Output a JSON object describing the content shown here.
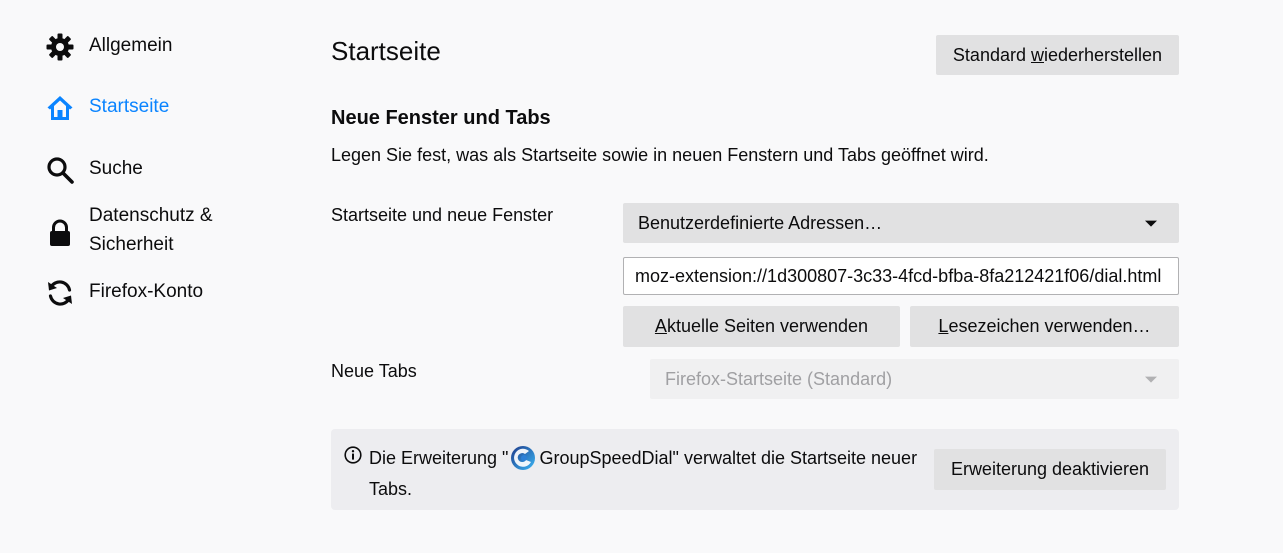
{
  "sidebar": {
    "items": [
      {
        "label": "Allgemein",
        "icon": "gear-icon"
      },
      {
        "label": "Startseite",
        "icon": "home-icon",
        "selected": true
      },
      {
        "label": "Suche",
        "icon": "search-icon"
      },
      {
        "label": "Datenschutz & Sicherheit",
        "icon": "lock-icon"
      },
      {
        "label": "Firefox-Konto",
        "icon": "sync-icon"
      }
    ]
  },
  "main": {
    "title": "Startseite",
    "restore_button": {
      "prefix": "Standard ",
      "accesskey": "w",
      "suffix": "iederherstellen"
    },
    "section": {
      "title": "Neue Fenster und Tabs",
      "description": "Legen Sie fest, was als Startseite sowie in neuen Fenstern und Tabs geöffnet wird."
    },
    "homepage": {
      "label": "Startseite und neue Fenster",
      "selected": "Benutzerdefinierte Adressen…",
      "url_value": "moz-extension://1d300807-3c33-4fcd-bfba-8fa212421f06/dial.html",
      "current_pages_button": {
        "accesskey": "A",
        "rest": "ktuelle Seiten verwenden"
      },
      "bookmark_button": {
        "accesskey": "L",
        "rest": "esezeichen verwenden…"
      }
    },
    "new_tabs": {
      "label": "Neue Tabs",
      "selected": "Firefox-Startseite (Standard)"
    },
    "notice": {
      "text_before": "Die Erweiterung \"",
      "extension_name": "GroupSpeedDial",
      "text_after": "\" verwaltet die Startseite neuer Tabs.",
      "button_label": "Erweiterung deaktivieren"
    }
  },
  "colors": {
    "accent": "#0a84ff",
    "background": "#f9f9fa",
    "button": "#e1e1e2",
    "notice_bg": "#ededf0"
  }
}
